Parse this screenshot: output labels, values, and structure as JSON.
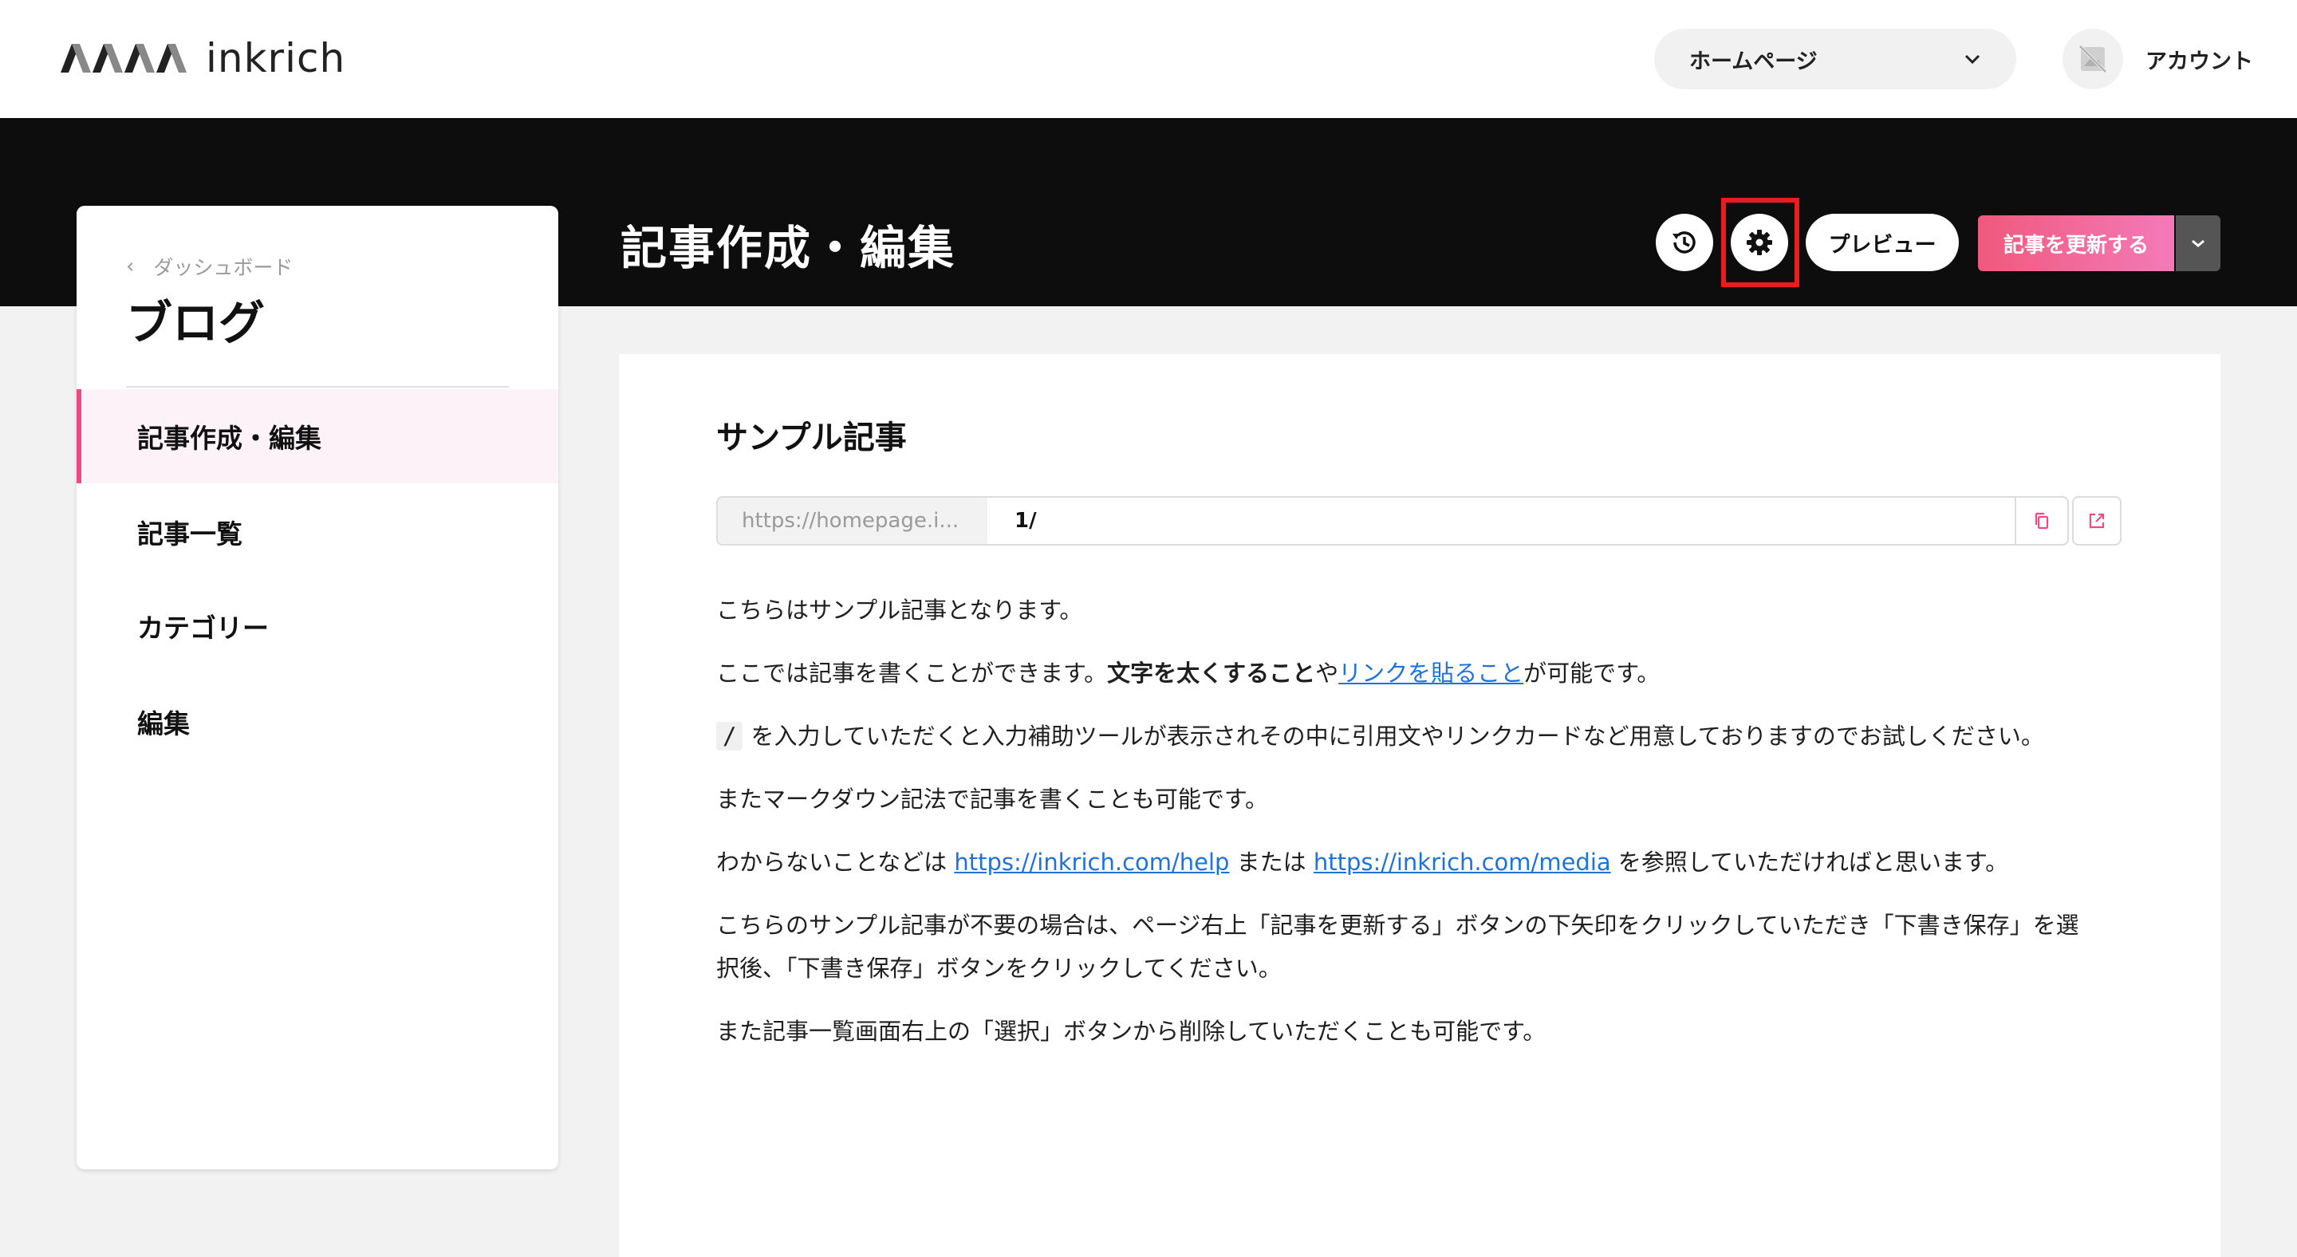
{
  "header": {
    "logo_text": "inkrich",
    "site_select_label": "ホームページ",
    "account_label": "アカウント"
  },
  "toolbar": {
    "page_title": "記事作成・編集",
    "preview_label": "プレビュー",
    "update_label": "記事を更新する"
  },
  "sidebar": {
    "back_label": "ダッシュボード",
    "title": "ブログ",
    "items": [
      {
        "label": "記事作成・編集"
      },
      {
        "label": "記事一覧"
      },
      {
        "label": "カテゴリー"
      },
      {
        "label": "編集"
      }
    ]
  },
  "article": {
    "title": "サンプル記事",
    "url_prefix": "https://homepage.i...",
    "url_slug": "1/",
    "p1": "こちらはサンプル記事となります。",
    "p2_before": "ここでは記事を書くことができます。",
    "p2_bold": "文字を太くすること",
    "p2_mid": "や",
    "p2_link": "リンクを貼ること",
    "p2_after": "が可能です。",
    "p3_code": "/",
    "p3_text": "を入力していただくと入力補助ツールが表示されその中に引用文やリンクカードなど用意しておりますのでお試しください。",
    "p4": "またマークダウン記法で記事を書くことも可能です。",
    "p5_before": "わからないことなどは ",
    "p5_link1": "https://inkrich.com/help",
    "p5_mid": " または ",
    "p5_link2": "https://inkrich.com/media",
    "p5_after": " を参照していただければと思います。",
    "p6": "こちらのサンプル記事が不要の場合は、ページ右上「記事を更新する」ボタンの下矢印をクリックしていただき「下書き保存」を選択後、「下書き保存」ボタンをクリックしてください。",
    "p7": "また記事一覧画面右上の「選択」ボタンから削除していただくことも可能です。"
  },
  "colors": {
    "accent_pink": "#ee4a82",
    "highlight_red": "#e81e1e",
    "link_blue": "#1f73d8",
    "dark_band": "#0d0d0d"
  }
}
